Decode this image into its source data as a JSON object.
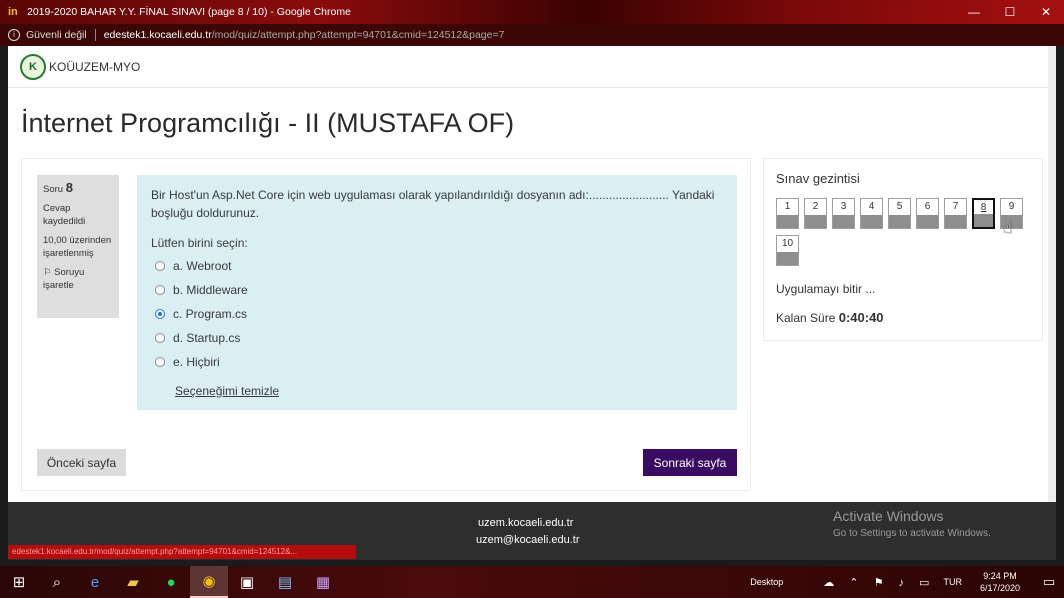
{
  "window": {
    "title": "2019-2020 BAHAR Y.Y. FİNAL SINAVI (page 8 / 10) - Google Chrome",
    "app_icon": "in",
    "controls": {
      "minimize": "—",
      "maximize": "☐",
      "close": "✕"
    }
  },
  "address_bar": {
    "security_label": "Güvenli değil",
    "host": "edestek1.kocaeli.edu.tr",
    "path": "/mod/quiz/attempt.php?attempt=94701&cmid=124512&page=7"
  },
  "site": {
    "logo_text": "K",
    "name": "KOÜUZEM-MYO"
  },
  "page_title": "İnternet Programcılığı - II (MUSTAFA OF)",
  "question": {
    "label_prefix": "Soru",
    "number": "8",
    "status": "Cevap kaydedildi",
    "score": "10,00 üzerinden işaretlenmiş",
    "flag_label": "Soruyu işaretle",
    "text": "Bir Host'un Asp.Net Core için web uygulaması olarak yapılandırıldığı dosyanın adı:........................ Yandaki boşluğu doldurunuz.",
    "prompt": "Lütfen birini seçin:",
    "answers": [
      {
        "label": "a. Webroot",
        "checked": false
      },
      {
        "label": "b. Middleware",
        "checked": false
      },
      {
        "label": "c. Program.cs",
        "checked": true
      },
      {
        "label": "d. Startup.cs",
        "checked": false
      },
      {
        "label": "e. Hiçbiri",
        "checked": false
      }
    ],
    "clear_choice": "Seçeneğimi temizle"
  },
  "buttons": {
    "previous": "Önceki sayfa",
    "next": "Sonraki sayfa"
  },
  "quiz_nav": {
    "title": "Sınav gezintisi",
    "pages": [
      "1",
      "2",
      "3",
      "4",
      "5",
      "6",
      "7",
      "8",
      "9",
      "10"
    ],
    "current": "8",
    "finish": "Uygulamayı bitir ...",
    "time_label": "Kalan Süre",
    "time_value": "0:40:40"
  },
  "footer": {
    "site": "uzem.kocaeli.edu.tr",
    "email": "uzem@kocaeli.edu.tr"
  },
  "watermark": {
    "line1": "Activate Windows",
    "line2": "Go to Settings to activate Windows."
  },
  "status_url": "edestek1.kocaeli.edu.tr/mod/quiz/attempt.php?attempt=94701&cmid=124512&...",
  "taskbar": {
    "desktop_label": "Desktop",
    "language": "TUR",
    "time": "9:24 PM",
    "date": "6/17/2020"
  }
}
